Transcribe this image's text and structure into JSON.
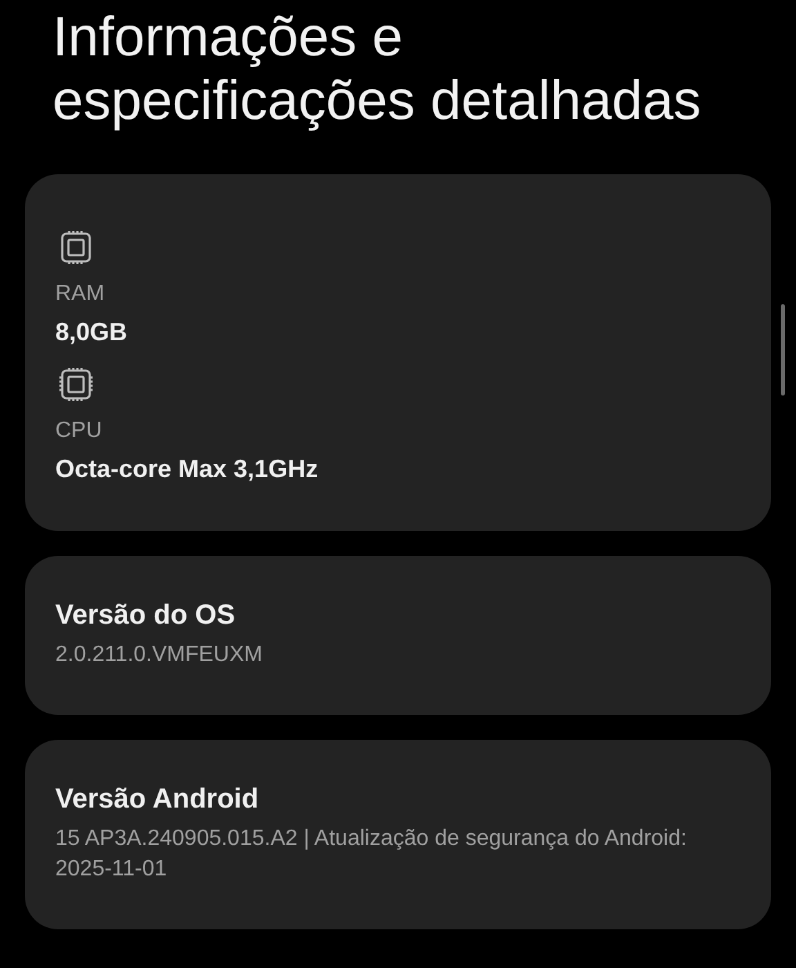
{
  "title": "Informações e especificações detalhadas",
  "specs": [
    {
      "kind": "ram",
      "label": "RAM",
      "value": "8,0GB"
    },
    {
      "kind": "cpu",
      "label": "CPU",
      "value": "Octa-core Max 3,1GHz"
    }
  ],
  "info_cards": [
    {
      "title": "Versão do OS",
      "value": "2.0.211.0.VMFEUXM"
    },
    {
      "title": "Versão Android",
      "value": "15 AP3A.240905.015.A2 | Atualização de segurança do Android: 2025-11-01"
    }
  ]
}
